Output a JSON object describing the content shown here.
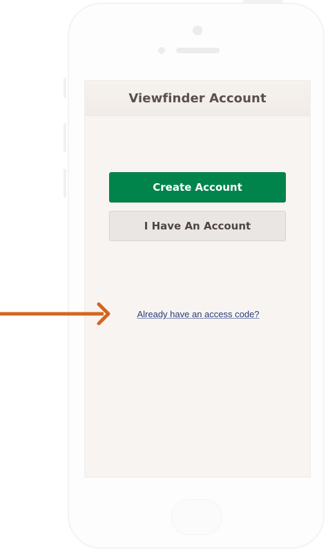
{
  "screen": {
    "nav_title": "Viewfinder Account",
    "create_account_label": "Create Account",
    "have_account_label": "I Have An Account",
    "access_code_link": "Already have an access code?"
  },
  "colors": {
    "primary_button": "#00844c",
    "secondary_button": "#e9e6e3",
    "screen_background": "#f7f4f1",
    "link": "#2b3b78",
    "annotation_arrow": "#d4651c"
  },
  "icons": {
    "annotation": "arrow-right-icon"
  }
}
